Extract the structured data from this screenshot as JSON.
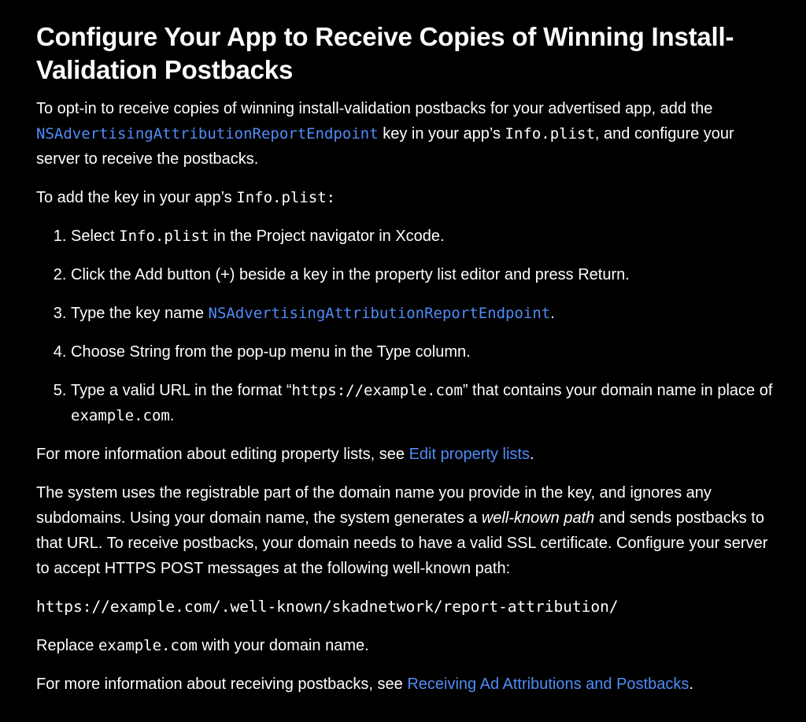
{
  "title": "Configure Your App to Receive Copies of Winning Install-Validation Postbacks",
  "intro": {
    "part1": "To opt-in to receive copies of winning install-validation postbacks for your advertised app, add the ",
    "key_link": "NSAdvertisingAttributionReportEndpoint",
    "part2": " key in your app’s ",
    "plist": "Info.plist",
    "part3": ", and configure your server to receive the postbacks."
  },
  "add_key": {
    "text": "To add the key in your app’s ",
    "plist": "Info.plist",
    "colon": ":"
  },
  "steps": {
    "s1": {
      "pre": "Select ",
      "code": "Info.plist",
      "post": " in the Project navigator in Xcode."
    },
    "s2": {
      "text": "Click the Add button (+) beside a key in the property list editor and press Return."
    },
    "s3": {
      "pre": "Type the key name ",
      "code": "NSAdvertisingAttributionReportEndpoint",
      "post": "."
    },
    "s4": {
      "text": "Choose String from the pop-up menu in the Type column."
    },
    "s5": {
      "pre": "Type a valid URL in the format “",
      "code": "https://example.com",
      "mid": "” that contains your domain name in place of ",
      "code2": "example.com",
      "post": "."
    }
  },
  "more_info_plist": {
    "pre": "For more information about editing property lists, see ",
    "link": "Edit property lists",
    "post": "."
  },
  "system": {
    "part1": "The system uses the registrable part of the domain name you provide in the key, and ignores any subdomains. Using your domain name, the system generates a ",
    "em": "well-known path",
    "part2": " and sends postbacks to that URL. To receive postbacks, your domain needs to have a valid SSL certificate. Configure your server to accept HTTPS POST messages at the following well-known path:"
  },
  "well_known_path": "https://example.com/.well-known/skadnetwork/report-attribution/",
  "replace": {
    "pre": "Replace ",
    "code": "example.com",
    "post": " with your domain name."
  },
  "more_info_postbacks": {
    "pre": "For more information about receiving postbacks, see ",
    "link": "Receiving Ad Attributions and Postbacks",
    "post": "."
  },
  "colors": {
    "background": "#000000",
    "text": "#ffffff",
    "link": "#4f8df7"
  }
}
